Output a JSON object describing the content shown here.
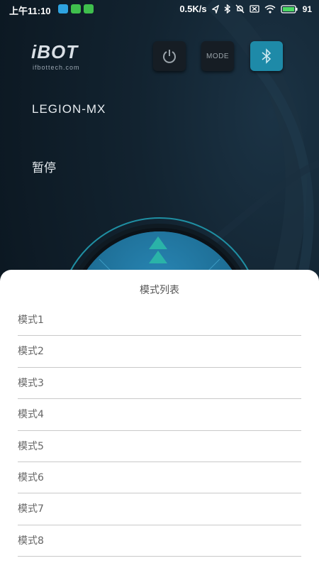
{
  "status_bar": {
    "time": "上午11:10",
    "network_speed": "0.5K/s",
    "battery": "91"
  },
  "header": {
    "logo_text": "iBOT",
    "logo_subtext": "ifbottech.com",
    "mode_label": "MODE"
  },
  "device": {
    "name": "LEGION-MX",
    "status": "暂停"
  },
  "colors": {
    "accent": "#1e8aa8",
    "background": "#0f1d2a",
    "sheet": "#ffffff"
  },
  "mode_sheet": {
    "title": "模式列表",
    "items": [
      "模式1",
      "模式2",
      "模式3",
      "模式4",
      "模式5",
      "模式6",
      "模式7",
      "模式8"
    ]
  }
}
